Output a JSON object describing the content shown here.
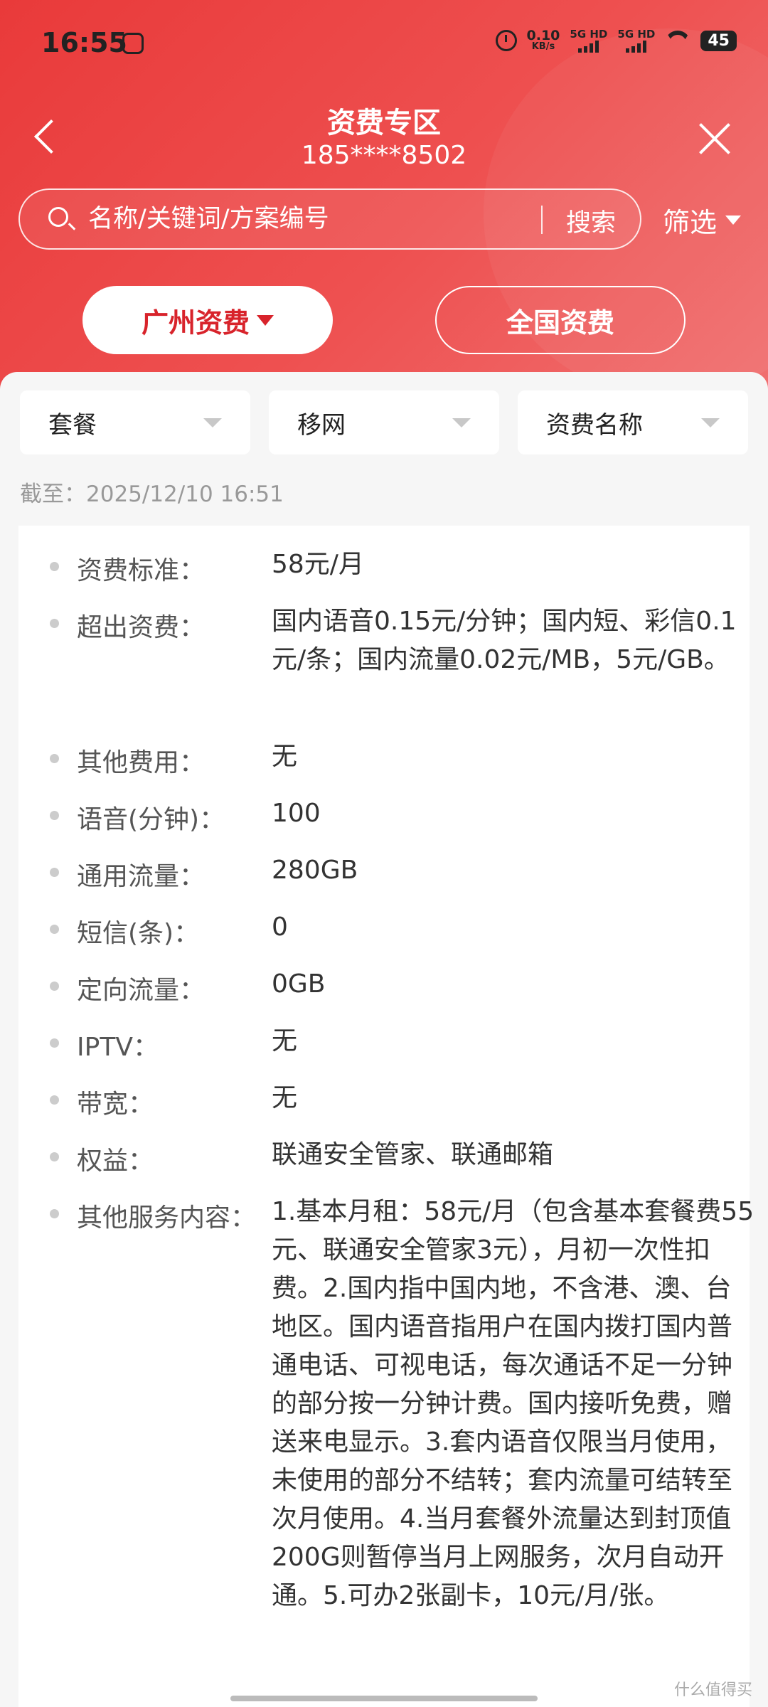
{
  "status": {
    "time": "16:55",
    "net_speed_value": "0.10",
    "net_speed_unit": "KB/s",
    "sim1_label": "5G HD",
    "sim2_label": "5G HD",
    "battery": "45"
  },
  "header": {
    "title": "资费专区",
    "phone": "185****8502"
  },
  "search": {
    "placeholder": "名称/关键词/方案编号",
    "button_label": "搜索",
    "filter_label": "筛选"
  },
  "region_tabs": [
    {
      "label": "广州资费",
      "active": true
    },
    {
      "label": "全国资费",
      "active": false
    }
  ],
  "filters": [
    {
      "label": "套餐"
    },
    {
      "label": "移网"
    },
    {
      "label": "资费名称"
    }
  ],
  "timestamp": "截至：2025/12/10 16:51",
  "details": [
    {
      "label": "资费标准：",
      "value": "58元/月"
    },
    {
      "label": "超出资费：",
      "value": "国内语音0.15元/分钟；国内短、彩信0.1元/条；国内流量0.02元/MB，5元/GB。"
    },
    {
      "label": "其他费用：",
      "value": "无"
    },
    {
      "label": "语音(分钟)：",
      "value": "100"
    },
    {
      "label": "通用流量：",
      "value": "280GB"
    },
    {
      "label": "短信(条)：",
      "value": "0"
    },
    {
      "label": "定向流量：",
      "value": "0GB"
    },
    {
      "label": "IPTV：",
      "value": "无"
    },
    {
      "label": "带宽：",
      "value": "无"
    },
    {
      "label": "权益：",
      "value": "联通安全管家、联通邮箱"
    },
    {
      "label": "其他服务内容：",
      "value": "1.基本月租：58元/月（包含基本套餐费55元、联通安全管家3元），月初一次性扣费。2.国内指中国内地，不含港、澳、台地区。国内语音指用户在国内拨打国内普通电话、可视电话，每次通话不足一分钟的部分按一分钟计费。国内接听免费，赠送来电显示。3.套内语音仅限当月使用，未使用的部分不结转；套内流量可结转至次月使用。4.当月套餐外流量达到封顶值200G则暂停当月上网服务，次月自动开通。5.可办2张副卡，10元/月/张。"
    }
  ],
  "watermark": "什么值得买"
}
